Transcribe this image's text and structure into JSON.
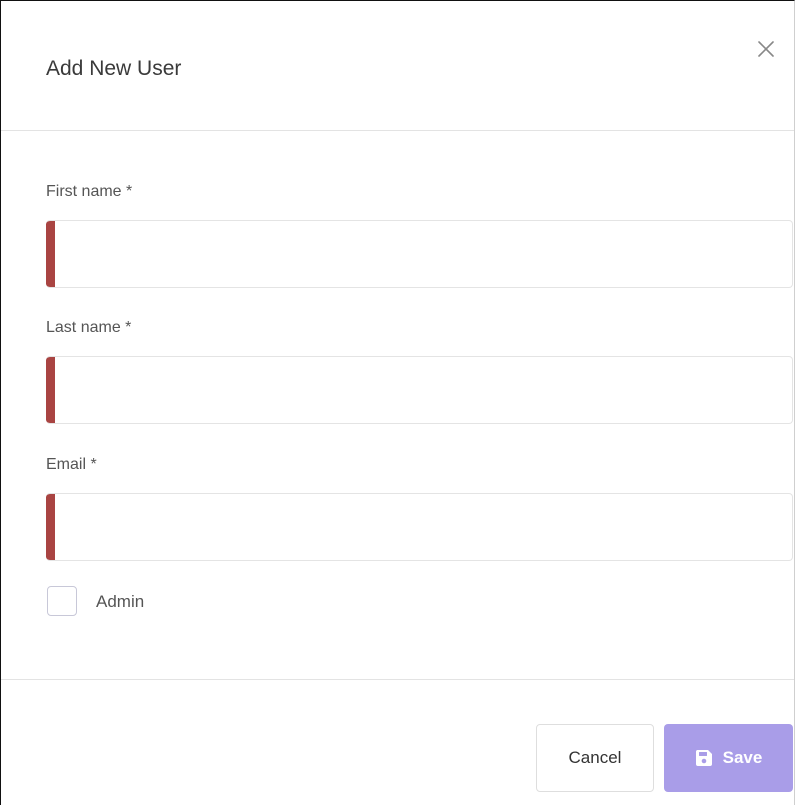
{
  "dialog": {
    "title": "Add New User"
  },
  "form": {
    "first_name": {
      "label": "First name *",
      "value": "",
      "placeholder": ""
    },
    "last_name": {
      "label": "Last name *",
      "value": "",
      "placeholder": ""
    },
    "email": {
      "label": "Email *",
      "value": "",
      "placeholder": ""
    },
    "admin": {
      "label": "Admin",
      "checked": false
    }
  },
  "footer": {
    "cancel_label": "Cancel",
    "save_label": "Save"
  },
  "colors": {
    "invalid_indicator": "#a94442",
    "save_button": "#a99de8"
  },
  "icons": {
    "close": "close-icon",
    "save": "floppy-disk-icon"
  }
}
